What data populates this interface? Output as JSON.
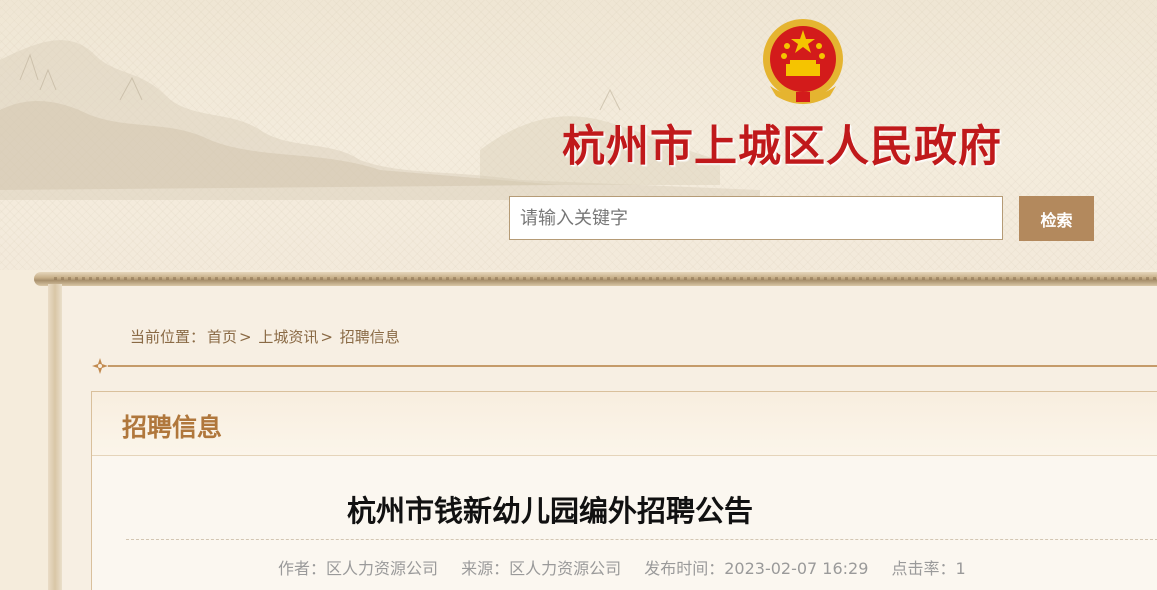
{
  "header": {
    "site_title": "杭州市上城区人民政府",
    "emblem": "national-emblem",
    "search": {
      "placeholder": "请输入关键字",
      "value": "",
      "button_label": "检索"
    }
  },
  "breadcrumb": {
    "prefix": "当前位置：",
    "items": [
      "首页",
      "上城资讯",
      "招聘信息"
    ],
    "separator": ">"
  },
  "section": {
    "title": "招聘信息"
  },
  "article": {
    "title": "杭州市钱新幼儿园编外招聘公告",
    "meta": {
      "author": "作者：区人力资源公司",
      "source": "来源：区人力资源公司",
      "published": "发布时间：2023-02-07 16:29",
      "hits": "点击率：1"
    }
  },
  "colors": {
    "title_red": "#c0191b",
    "accent_brown": "#b3895d",
    "panel_title": "#b0773c"
  }
}
